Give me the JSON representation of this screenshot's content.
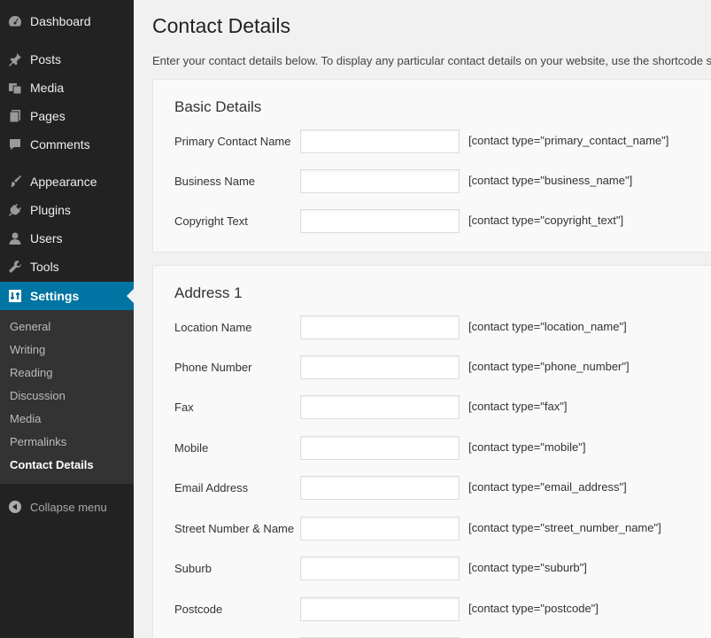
{
  "sidebar": {
    "menu": [
      {
        "label": "Dashboard",
        "icon": "dashboard-icon"
      },
      {
        "label": "Posts",
        "icon": "pushpin-icon"
      },
      {
        "label": "Media",
        "icon": "media-icon"
      },
      {
        "label": "Pages",
        "icon": "pages-icon"
      },
      {
        "label": "Comments",
        "icon": "comment-icon"
      },
      {
        "label": "Appearance",
        "icon": "paintbrush-icon"
      },
      {
        "label": "Plugins",
        "icon": "plug-icon"
      },
      {
        "label": "Users",
        "icon": "user-icon"
      },
      {
        "label": "Tools",
        "icon": "wrench-icon"
      },
      {
        "label": "Settings",
        "icon": "settings-icon"
      }
    ],
    "submenu": [
      "General",
      "Writing",
      "Reading",
      "Discussion",
      "Media",
      "Permalinks",
      "Contact Details"
    ],
    "collapse_label": "Collapse menu"
  },
  "main": {
    "title": "Contact Details",
    "intro": "Enter your contact details below. To display any particular contact details on your website, use the shortcode su",
    "sections": [
      {
        "title": "Basic Details",
        "fields": [
          {
            "label": "Primary Contact Name",
            "value": "",
            "shortcode": "[contact type=\"primary_contact_name\"]"
          },
          {
            "label": "Business Name",
            "value": "",
            "shortcode": "[contact type=\"business_name\"]"
          },
          {
            "label": "Copyright Text",
            "value": "",
            "shortcode": "[contact type=\"copyright_text\"]"
          }
        ]
      },
      {
        "title": "Address 1",
        "fields": [
          {
            "label": "Location Name",
            "value": "",
            "shortcode": "[contact type=\"location_name\"]"
          },
          {
            "label": "Phone Number",
            "value": "",
            "shortcode": "[contact type=\"phone_number\"]"
          },
          {
            "label": "Fax",
            "value": "",
            "shortcode": "[contact type=\"fax\"]"
          },
          {
            "label": "Mobile",
            "value": "",
            "shortcode": "[contact type=\"mobile\"]"
          },
          {
            "label": "Email Address",
            "value": "",
            "shortcode": "[contact type=\"email_address\"]"
          },
          {
            "label": "Street Number & Name",
            "value": "",
            "shortcode": "[contact type=\"street_number_name\"]"
          },
          {
            "label": "Suburb",
            "value": "",
            "shortcode": "[contact type=\"suburb\"]"
          },
          {
            "label": "Postcode",
            "value": "",
            "shortcode": "[contact type=\"postcode\"]"
          }
        ]
      }
    ]
  },
  "colors": {
    "sidebar_bg": "#222222",
    "submenu_bg": "#333333",
    "accent": "#0074a2",
    "page_bg": "#f1f1f1",
    "panel_bg": "#f9f9f9"
  }
}
